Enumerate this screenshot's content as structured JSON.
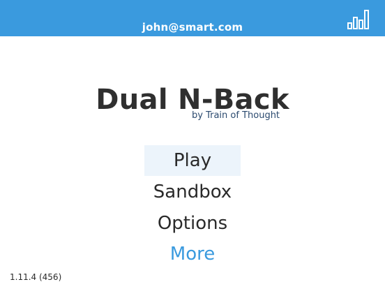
{
  "header": {
    "account_email": "john@smart.com",
    "stats_icon": "bar-chart-icon",
    "background_color": "#3a9ade"
  },
  "title": {
    "main": "Dual N-Back",
    "subtitle": "by Train of Thought"
  },
  "menu": {
    "items": [
      {
        "label": "Play",
        "selected": true
      },
      {
        "label": "Sandbox",
        "selected": false
      },
      {
        "label": "Options",
        "selected": false
      },
      {
        "label": "More",
        "selected": false,
        "accent_color": "#3a9ade"
      }
    ]
  },
  "footer": {
    "version": "1.11.4 (456)"
  }
}
